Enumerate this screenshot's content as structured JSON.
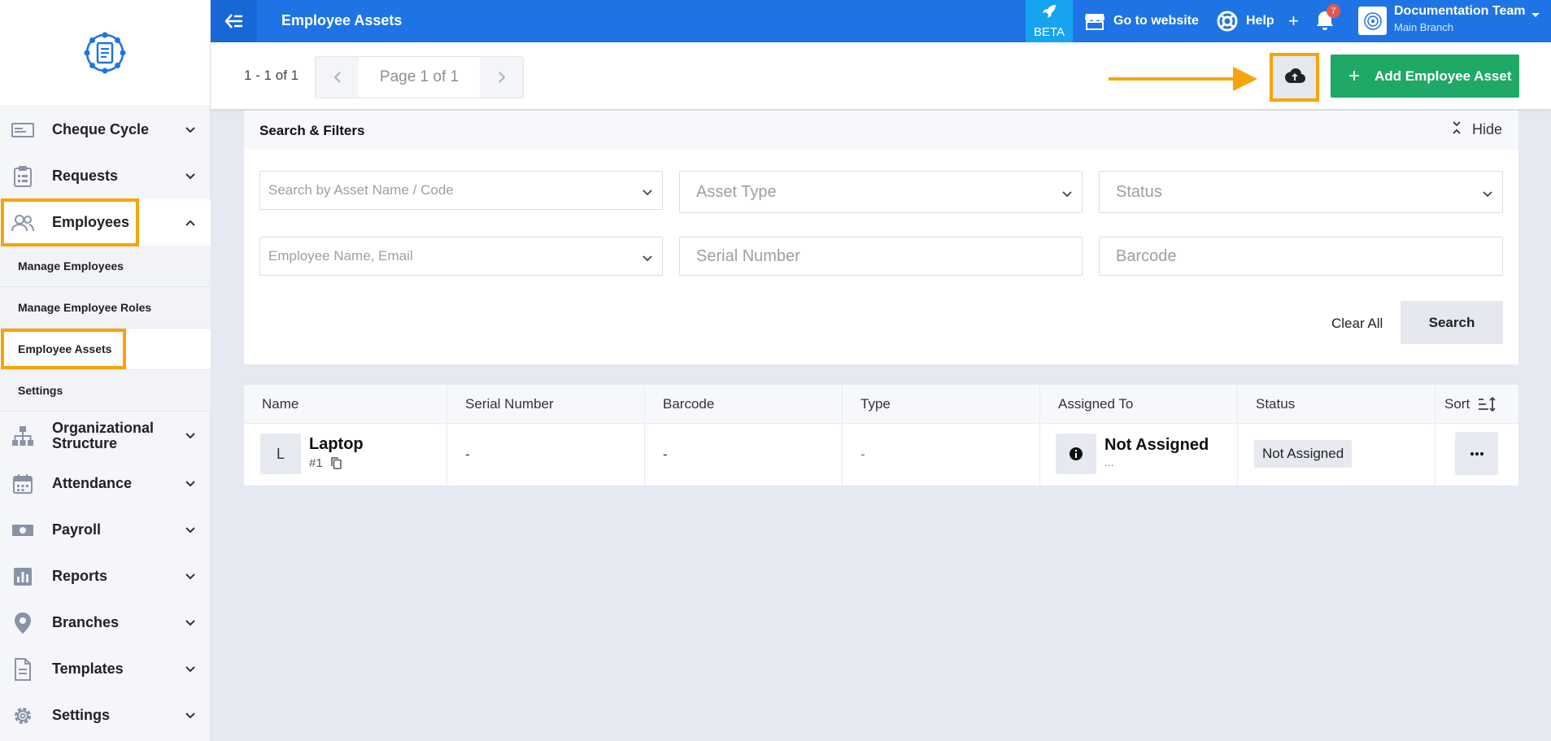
{
  "topbar": {
    "title": "Employee Assets",
    "beta_label": "BETA",
    "go_to_website": "Go to website",
    "help": "Help",
    "notification_count": "7",
    "user_name": "Documentation Team",
    "user_branch": "Main Branch"
  },
  "sidebar": {
    "items": [
      {
        "label": "Cheque Cycle",
        "icon": "cheque-icon"
      },
      {
        "label": "Requests",
        "icon": "clipboard-icon"
      },
      {
        "label": "Employees",
        "icon": "users-icon"
      },
      {
        "label": "Organizational Structure",
        "icon": "hierarchy-icon"
      },
      {
        "label": "Attendance",
        "icon": "calendar-icon"
      },
      {
        "label": "Payroll",
        "icon": "money-icon"
      },
      {
        "label": "Reports",
        "icon": "chart-icon"
      },
      {
        "label": "Branches",
        "icon": "location-icon"
      },
      {
        "label": "Templates",
        "icon": "document-icon"
      },
      {
        "label": "Settings",
        "icon": "gear-icon"
      }
    ],
    "sub_items": [
      "Manage Employees",
      "Manage Employee Roles",
      "Employee Assets",
      "Settings"
    ]
  },
  "header": {
    "count": "1 - 1 of 1",
    "page_label": "Page 1 of 1",
    "add_button": "Add Employee Asset"
  },
  "filters": {
    "title": "Search & Filters",
    "hide": "Hide",
    "search_placeholder": "Search by Asset Name / Code",
    "asset_type": "Asset Type",
    "status": "Status",
    "employee_placeholder": "Employee Name, Email",
    "serial_number": "Serial Number",
    "barcode": "Barcode",
    "clear_all": "Clear All",
    "search": "Search"
  },
  "table": {
    "columns": [
      "Name",
      "Serial Number",
      "Barcode",
      "Type",
      "Assigned To",
      "Status",
      "Sort"
    ],
    "rows": [
      {
        "avatar": "L",
        "name": "Laptop",
        "code": "#1",
        "serial": "-",
        "barcode": "-",
        "type": "-",
        "assigned_to": "Not Assigned",
        "assigned_sub": "...",
        "status": "Not Assigned"
      }
    ]
  },
  "colors": {
    "primary": "#1e74e4",
    "success": "#1fa866",
    "highlight": "#f6a408",
    "beta": "#16a3f0"
  }
}
